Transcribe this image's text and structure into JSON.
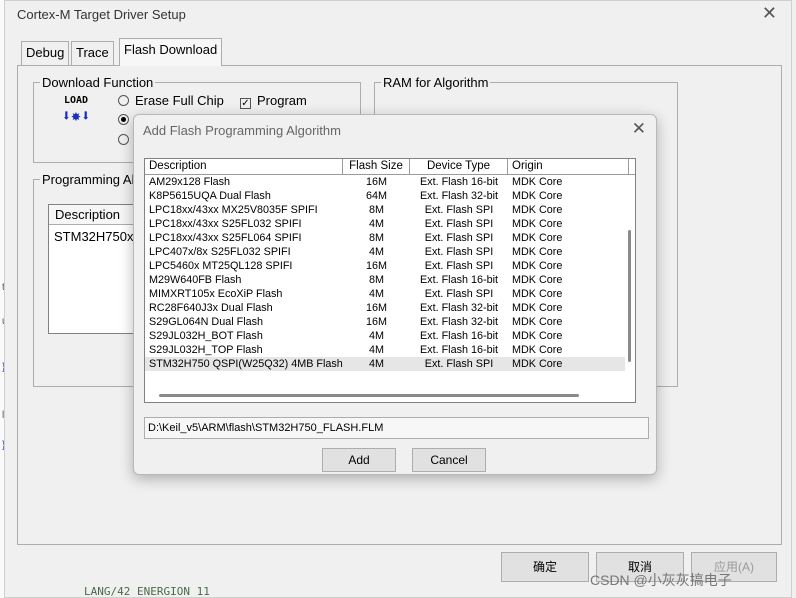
{
  "window": {
    "title": "Cortex-M Target Driver Setup",
    "close_glyph": "✕"
  },
  "tabs": [
    {
      "label": "Debug"
    },
    {
      "label": "Trace"
    },
    {
      "label": "Flash Download"
    }
  ],
  "download_function": {
    "legend": "Download Function",
    "load_icon_text": "LOAD",
    "erase_full_chip": "Erase Full Chip",
    "program": "Program"
  },
  "ram_for_algorithm": {
    "legend": "RAM for Algorithm"
  },
  "programming_algorithm": {
    "legend": "Programming Al",
    "column_description": "Description",
    "row_1": "STM32H750xx"
  },
  "dialog": {
    "title": "Add Flash Programming Algorithm",
    "close_glyph": "✕",
    "columns": [
      "Description",
      "Flash Size",
      "Device Type",
      "Origin"
    ],
    "rows": [
      [
        "AM29x128 Flash",
        "16M",
        "Ext. Flash 16-bit",
        "MDK Core"
      ],
      [
        "K8P5615UQA Dual Flash",
        "64M",
        "Ext. Flash 32-bit",
        "MDK Core"
      ],
      [
        "LPC18xx/43xx MX25V8035F SPIFI",
        "8M",
        "Ext. Flash SPI",
        "MDK Core"
      ],
      [
        "LPC18xx/43xx S25FL032 SPIFI",
        "4M",
        "Ext. Flash SPI",
        "MDK Core"
      ],
      [
        "LPC18xx/43xx S25FL064 SPIFI",
        "8M",
        "Ext. Flash SPI",
        "MDK Core"
      ],
      [
        "LPC407x/8x S25FL032 SPIFI",
        "4M",
        "Ext. Flash SPI",
        "MDK Core"
      ],
      [
        "LPC5460x MT25QL128 SPIFI",
        "16M",
        "Ext. Flash SPI",
        "MDK Core"
      ],
      [
        "M29W640FB Flash",
        "8M",
        "Ext. Flash 16-bit",
        "MDK Core"
      ],
      [
        "MIMXRT105x EcoXiP Flash",
        "4M",
        "Ext. Flash SPI",
        "MDK Core"
      ],
      [
        "RC28F640J3x Dual Flash",
        "16M",
        "Ext. Flash 32-bit",
        "MDK Core"
      ],
      [
        "S29GL064N Dual Flash",
        "16M",
        "Ext. Flash 32-bit",
        "MDK Core"
      ],
      [
        "S29JL032H_BOT Flash",
        "4M",
        "Ext. Flash 16-bit",
        "MDK Core"
      ],
      [
        "S29JL032H_TOP Flash",
        "4M",
        "Ext. Flash 16-bit",
        "MDK Core"
      ],
      [
        "STM32H750 QSPI(W25Q32) 4MB Flash",
        "4M",
        "Ext. Flash SPI",
        "MDK Core"
      ]
    ],
    "selected_row": 13,
    "path": "D:\\Keil_v5\\ARM\\flash\\STM32H750_FLASH.FLM",
    "add_label": "Add",
    "cancel_label": "Cancel"
  },
  "footer": {
    "ok_label": "确定",
    "cancel_label": "取消",
    "apply_label": "应用(A)"
  },
  "background": {
    "code_text": "LANG/42 ENERGION 11",
    "watermark": "CSDN @小灰灰搞电子"
  }
}
